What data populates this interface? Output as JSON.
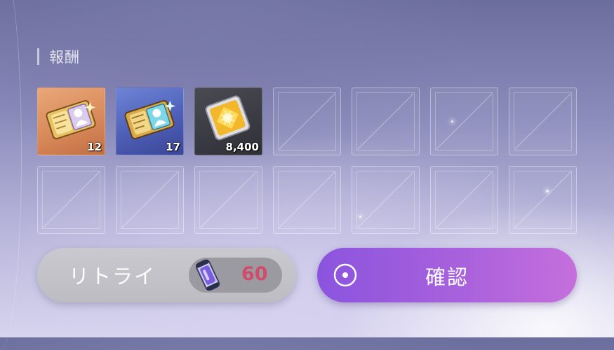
{
  "section": {
    "title": "報酬"
  },
  "rewards": {
    "items": [
      {
        "icon": "orange-ticket-icon",
        "quantity": "12"
      },
      {
        "icon": "blue-ticket-icon",
        "quantity": "17"
      },
      {
        "icon": "gold-gem-icon",
        "quantity": "8,400"
      }
    ]
  },
  "buttons": {
    "retry_label": "リトライ",
    "retry_cost": "60",
    "retry_cost_icon": "energy-capsule-icon",
    "confirm_label": "確認",
    "confirm_icon": "circle-dot-icon"
  },
  "colors": {
    "confirm_gradient_start": "#8b54de",
    "confirm_gradient_end": "#c56fdc",
    "cost_value": "#d14c6a",
    "rarity_orange": "#d98a5a",
    "rarity_blue": "#4d5fb6"
  }
}
